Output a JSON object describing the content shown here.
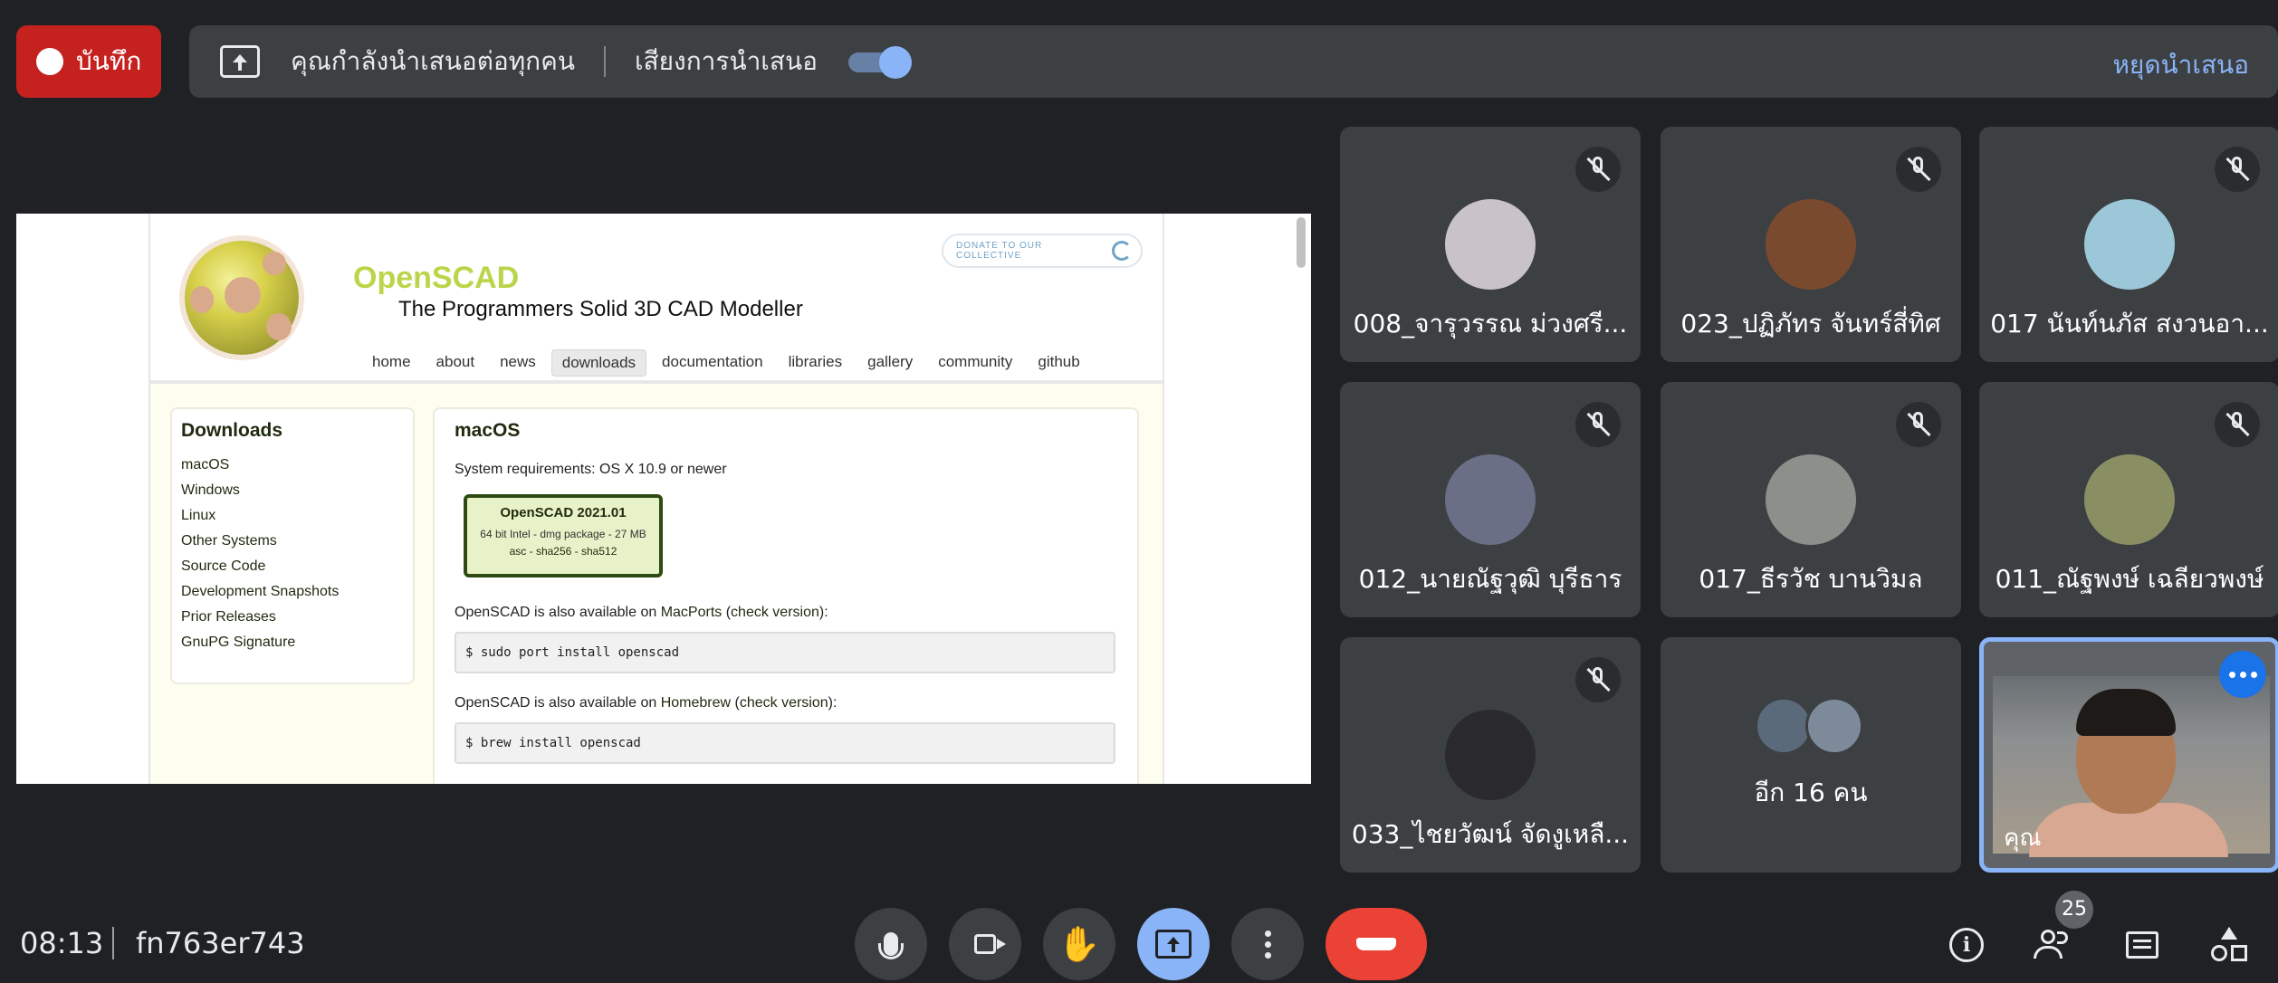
{
  "top_bar": {
    "record_label": "บันทึก",
    "presenting_text": "คุณกำลังนำเสนอต่อทุกคน",
    "audio_label": "เสียงการนำเสนอ",
    "audio_toggle_on": true,
    "stop_label": "หยุดนำเสนอ"
  },
  "shared_screen": {
    "site_title": "OpenSCAD",
    "site_subtitle": "The Programmers Solid 3D CAD Modeller",
    "donate_label": "DONATE TO OUR COLLECTIVE",
    "nav": [
      {
        "label": "home"
      },
      {
        "label": "about"
      },
      {
        "label": "news"
      },
      {
        "label": "downloads",
        "active": true
      },
      {
        "label": "documentation"
      },
      {
        "label": "libraries"
      },
      {
        "label": "gallery"
      },
      {
        "label": "community"
      },
      {
        "label": "github"
      }
    ],
    "sidebar": {
      "title": "Downloads",
      "links": [
        "macOS",
        "Windows",
        "Linux",
        "Other Systems",
        "Source Code",
        "Development Snapshots",
        "Prior Releases",
        "GnuPG Signature"
      ]
    },
    "main": {
      "title": "macOS",
      "requirements": "System requirements: OS X 10.9 or newer",
      "download": {
        "name": "OpenSCAD 2021.01",
        "desc": "64 bit Intel - dmg package - 27 MB",
        "sig": "asc - sha256 - sha512"
      },
      "macports_prefix": "OpenSCAD is also available on ",
      "macports_link": "MacPorts",
      "macports_check": "check version",
      "macports_cmd": "$ sudo port install openscad",
      "homebrew_prefix": "OpenSCAD is also available on ",
      "homebrew_link": "Homebrew",
      "homebrew_check": "check version",
      "homebrew_cmd": "$ brew install openscad"
    }
  },
  "participants": [
    {
      "name": "008_จารุวรรณ ม่วงศรี...",
      "muted": true,
      "avatar_color": "#c9c2c6"
    },
    {
      "name": "023_ปฏิภัทร จันทร์สี่ทิศ",
      "muted": true,
      "avatar_color": "#7a4a2e"
    },
    {
      "name": "017 นันท์นภัส สงวนอา...",
      "muted": true,
      "avatar_color": "#9bc7d8"
    },
    {
      "name": "012_นายณัฐวุฒิ บุรีธาร",
      "muted": true,
      "avatar_color": "#6b6f86"
    },
    {
      "name": "017_ธีรวัช บานวิมล",
      "muted": true,
      "avatar_color": "#8d8f8a"
    },
    {
      "name": "011_ณัฐพงษ์ เฉลียวพงษ์",
      "muted": true,
      "avatar_color": "#8a8f63"
    },
    {
      "name": "033_ไชยวัฒน์ จัดงูเหลื...",
      "muted": true,
      "avatar_color": "#2a2a2e"
    }
  ],
  "more_participants": {
    "label": "อีก 16 คน"
  },
  "self_tile": {
    "name": "คุณ"
  },
  "bottom_bar": {
    "time": "08:13",
    "meeting_code": "fn763er743",
    "participant_count": "25"
  },
  "colors": {
    "accent": "#8ab4f8",
    "danger": "#ea4335",
    "record": "#c5221f",
    "tile_bg": "#3c4043"
  }
}
